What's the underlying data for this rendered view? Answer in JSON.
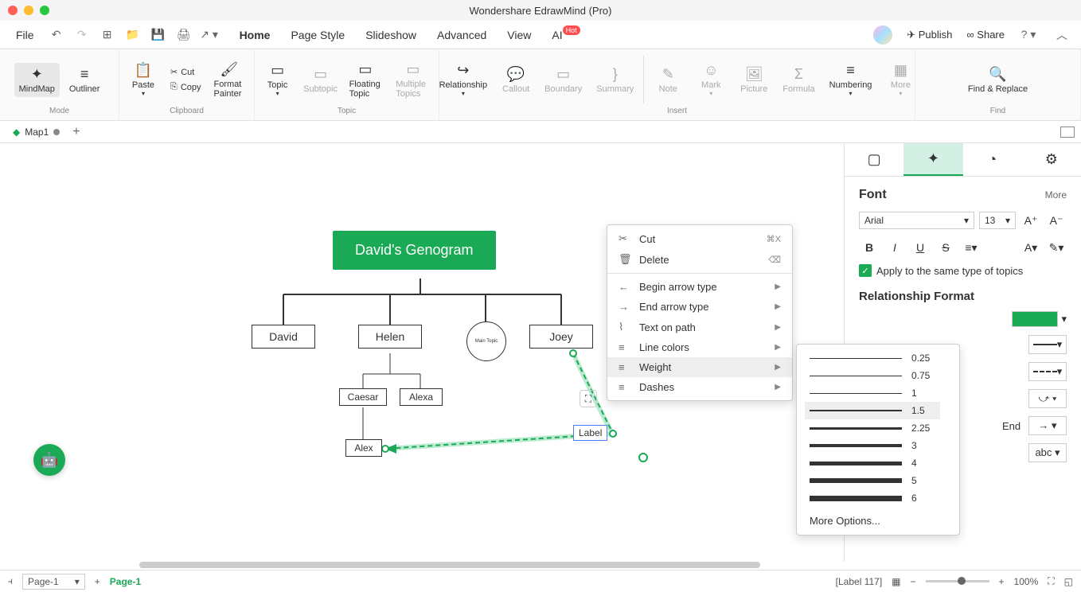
{
  "app_title": "Wondershare EdrawMind (Pro)",
  "menubar": {
    "file": "File",
    "tabs": [
      "Home",
      "Page Style",
      "Slideshow",
      "Advanced",
      "View",
      "AI"
    ],
    "hot": "Hot",
    "publish": "Publish",
    "share": "Share"
  },
  "ribbon": {
    "mode": {
      "label": "Mode",
      "items": [
        "MindMap",
        "Outliner"
      ]
    },
    "clipboard": {
      "label": "Clipboard",
      "paste": "Paste",
      "cut": "Cut",
      "copy": "Copy",
      "fmt": "Format Painter"
    },
    "topic": {
      "label": "Topic",
      "items": [
        "Topic",
        "Subtopic",
        "Floating Topic",
        "Multiple Topics"
      ]
    },
    "insert": {
      "label": "Insert",
      "items": [
        "Relationship",
        "Callout",
        "Boundary",
        "Summary",
        "Note",
        "Mark",
        "Picture",
        "Formula",
        "Numbering",
        "More"
      ]
    },
    "find": {
      "label": "Find",
      "item": "Find & Replace"
    }
  },
  "doctab": "Map1",
  "diagram": {
    "root": "David's Genogram",
    "n1": "David",
    "n2": "Helen",
    "n3": "Main Topic",
    "n4": "Joey",
    "c1": "Caesar",
    "c2": "Alexa",
    "c3": "Alex",
    "rel_label": "Label"
  },
  "ctx": {
    "cut": "Cut",
    "cut_kb": "⌘X",
    "delete": "Delete",
    "begin": "Begin arrow type",
    "end": "End arrow type",
    "top": "Text on path",
    "colors": "Line colors",
    "weight": "Weight",
    "dashes": "Dashes"
  },
  "weights": {
    "items": [
      {
        "v": "0.25",
        "w": 1
      },
      {
        "v": "0.75",
        "w": 1
      },
      {
        "v": "1",
        "w": 1
      },
      {
        "v": "1.5",
        "w": 2
      },
      {
        "v": "2.25",
        "w": 3
      },
      {
        "v": "3",
        "w": 4
      },
      {
        "v": "4",
        "w": 5
      },
      {
        "v": "5",
        "w": 6
      },
      {
        "v": "6",
        "w": 7
      }
    ],
    "more": "More Options..."
  },
  "rp": {
    "font_h": "Font",
    "more": "More",
    "fontfam": "Arial",
    "fontsize": "13",
    "apply": "Apply to the same type of topics",
    "rel_h": "Relationship Format",
    "end_lbl": "End"
  },
  "status": {
    "page_select": "Page-1",
    "page_tab": "Page-1",
    "label": "[Label 117]",
    "zoom": "100%"
  }
}
